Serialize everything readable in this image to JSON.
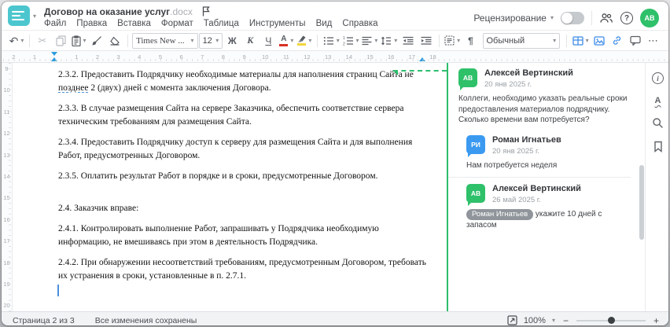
{
  "colors": {
    "accent_teal": "#4cc6ce",
    "accent_blue": "#3f8ce8",
    "ruler_marker_blue": "#2d9cdb",
    "comment_green": "#2ebd6b",
    "avatar_green": "#2fc06a",
    "avatar_blue": "#3b9af0",
    "font_color_bar": "#d93025",
    "highlight_bar": "#f2d43c"
  },
  "icons": {
    "caret": "▾",
    "undo": "↶",
    "cut": "✂",
    "pilcrow": "¶",
    "more": "⋯",
    "minus": "−",
    "plus": "+",
    "help": "?",
    "info": "i",
    "spellcheck_letter": "А",
    "named": [
      "app-logo",
      "chevron-down-icon",
      "flag-icon",
      "users-icon",
      "help-icon",
      "avatar",
      "undo-icon",
      "cut-icon",
      "copy-icon",
      "paste-icon",
      "format-painter-icon",
      "clear-style-icon",
      "font-color-icon",
      "highlight-icon",
      "bullet-list-icon",
      "numbered-list-icon",
      "align-icon",
      "line-spacing-icon",
      "outdent-icon",
      "indent-icon",
      "paragraph-settings-icon",
      "nonprinting-icon",
      "table-icon",
      "image-icon",
      "link-icon",
      "comment-icon",
      "more-icon",
      "info-icon",
      "spellcheck-icon",
      "search-icon",
      "bookmark-icon",
      "fit-width-icon"
    ]
  },
  "header": {
    "title": "Договор на оказание услуг",
    "title_ext": ".docx",
    "menu": [
      "Файл",
      "Правка",
      "Вставка",
      "Формат",
      "Таблица",
      "Инструменты",
      "Вид",
      "Справка"
    ],
    "review_label": "Рецензирование",
    "avatar_initials": "АВ"
  },
  "toolbar": {
    "font_name": "Times New ...",
    "font_size": "12",
    "bold": "Ж",
    "italic": "К",
    "underline": "Ч",
    "font_color_letter": "А",
    "style_name": "Обычный"
  },
  "ruler": {
    "h": [
      "2",
      "1",
      "",
      "1",
      "2",
      "3",
      "4",
      "5",
      "6",
      "7",
      "8",
      "9",
      "10",
      "11",
      "12",
      "13",
      "14",
      "15",
      "16",
      "17",
      "18"
    ],
    "v": [
      "9",
      "10",
      "11",
      "12",
      "13",
      "14",
      "15",
      "16",
      "17",
      "18",
      "19",
      "20"
    ]
  },
  "document": {
    "paragraphs": [
      {
        "l1": "2.3.2. Предоставить Подрядчику необходимые материалы для наполнения страниц Сайта не",
        "anchor": "позднее",
        "l2": " 2 (двух) дней с момента заключения Договора."
      },
      {
        "l1": "2.3.3. В случае размещения Сайта на сервере Заказчика, обеспечить соответствие сервера",
        "l2": "техническим требованиям для размещения Сайта."
      },
      {
        "l1": "2.3.4. Предоставить Подрядчику доступ к серверу для размещения Сайта и для выполнения",
        "l2": "Работ, предусмотренных Договором."
      },
      {
        "l1": "2.3.5. Оплатить результат Работ в порядке и в сроки, предусмотренные Договором."
      },
      {
        "l1": "2.4. Заказчик вправе:"
      },
      {
        "l1": "2.4.1. Контролировать выполнение Работ, запрашивать у Подрядчика необходимую",
        "l2": "информацию, не вмешиваясь при этом в деятельность Подрядчика."
      },
      {
        "l1": "2.4.2. При обнаружении несоответствий требованиям, предусмотренным Договором, требовать",
        "l2": "их устранения в сроки, установленные в п. 2.7.1."
      }
    ]
  },
  "comments": {
    "thread": [
      {
        "initials": "АВ",
        "name": "Алексей Вертинский",
        "date": "20 янв 2025 г.",
        "text": "Коллеги, необходимо указать реальные сроки предоставления материалов подрядчику. Сколько времени вам потребуется?"
      },
      {
        "initials": "РИ",
        "name": "Роман Игнатьев",
        "date": "20 янв 2025 г.",
        "text": "Нам потребуется неделя"
      },
      {
        "initials": "АВ",
        "name": "Алексей Вертинский",
        "date": "26 май 2025 г.",
        "mention": "Роман Игнатьев",
        "text": " укажите 10 дней с запасом"
      }
    ]
  },
  "statusbar": {
    "page_info": "Страница 2 из 3",
    "save_status": "Все изменения сохранены",
    "zoom": "100%"
  }
}
